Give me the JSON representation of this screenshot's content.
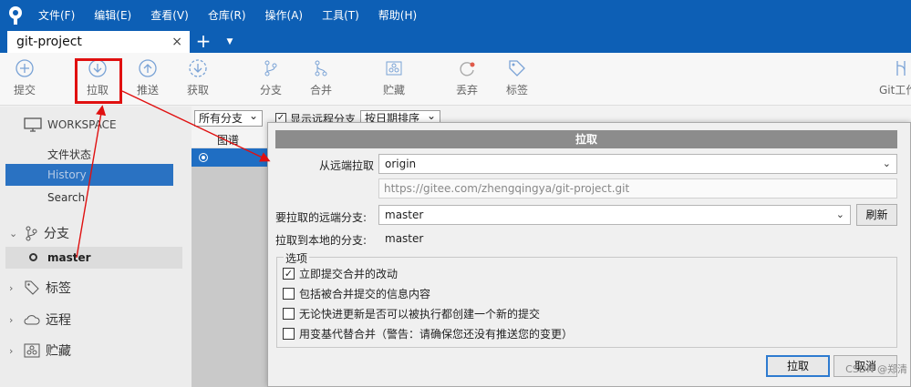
{
  "menu": [
    "文件(F)",
    "编辑(E)",
    "查看(V)",
    "仓库(R)",
    "操作(A)",
    "工具(T)",
    "帮助(H)"
  ],
  "tab": {
    "title": "git-project",
    "close": "×",
    "add": "+",
    "menu": "▼"
  },
  "toolbar": [
    {
      "label": "提交",
      "icon": "plus-circle-icon"
    },
    {
      "label": "拉取",
      "icon": "download-circle-icon"
    },
    {
      "label": "推送",
      "icon": "upload-circle-icon"
    },
    {
      "label": "获取",
      "icon": "fetch-circle-icon"
    },
    {
      "label": "分支",
      "icon": "branch-icon"
    },
    {
      "label": "合并",
      "icon": "merge-icon"
    },
    {
      "label": "贮藏",
      "icon": "stash-icon"
    },
    {
      "label": "丢弃",
      "icon": "discard-icon"
    },
    {
      "label": "标签",
      "icon": "tag-icon"
    },
    {
      "label": "Git工作",
      "icon": "gitflow-icon"
    }
  ],
  "sidebar": {
    "workspace": "WORKSPACE",
    "items": [
      "文件状态",
      "History",
      "Search"
    ],
    "branches_title": "分支",
    "current_branch": "master",
    "tags": "标签",
    "remotes": "远程",
    "stashes": "贮藏"
  },
  "history": {
    "branch_filter": "所有分支",
    "show_remote": "显示远程分支",
    "sort": "按日期排序",
    "col_graph": "图谱"
  },
  "dialog": {
    "title": "拉取",
    "remote_label": "从远端拉取",
    "remote_value": "origin",
    "url": "https://gitee.com/zhengqingya/git-project.git",
    "remote_branch_label": "要拉取的远端分支:",
    "remote_branch_value": "master",
    "refresh": "刷新",
    "local_branch_label": "拉取到本地的分支:",
    "local_branch_value": "master",
    "options_title": "选项",
    "options": [
      {
        "label": "立即提交合并的改动",
        "checked": true
      },
      {
        "label": "包括被合并提交的信息内容",
        "checked": false
      },
      {
        "label": "无论快进更新是否可以被执行都创建一个新的提交",
        "checked": false
      },
      {
        "label": "用变基代替合并（警告：请确保您还没有推送您的变更）",
        "checked": false
      }
    ],
    "ok": "拉取",
    "cancel": "取消"
  },
  "watermark": "CSDN @郑清",
  "colors": {
    "titlebar": "#0d5fb5",
    "selection": "#2a72c2",
    "annotation": "#e01010"
  }
}
